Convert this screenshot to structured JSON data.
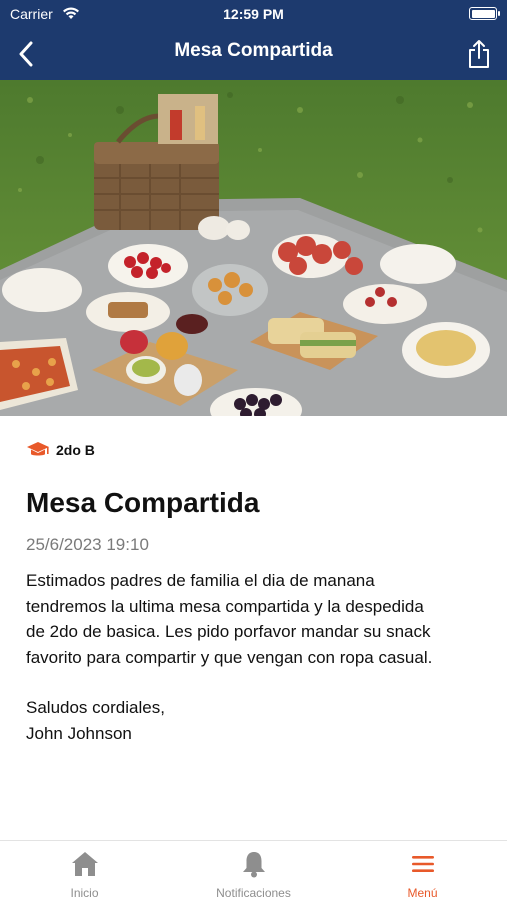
{
  "status_bar": {
    "carrier": "Carrier",
    "time": "12:59 PM"
  },
  "nav": {
    "title": "Mesa Compartida"
  },
  "post": {
    "class_label": "2do B",
    "title": "Mesa Compartida",
    "date": "25/6/2023 19:10",
    "body_lines": [
      "Estimados padres de familia el dia de manana",
      "tendremos la ultima mesa compartida y la despedida",
      "de 2do de basica. Les pido porfavor mandar su snack",
      "favorito para compartir y que vengan con ropa casual."
    ],
    "closing": "Saludos cordiales,",
    "signature": "John Johnson"
  },
  "tabs": [
    {
      "label": "Inicio",
      "icon": "home-icon"
    },
    {
      "label": "Notificaciones",
      "icon": "bell-icon"
    },
    {
      "label": "Menú",
      "icon": "menu-icon"
    }
  ],
  "colors": {
    "header": "#1d3a6e",
    "accent": "#e8592a",
    "muted": "#8e8e8e"
  }
}
